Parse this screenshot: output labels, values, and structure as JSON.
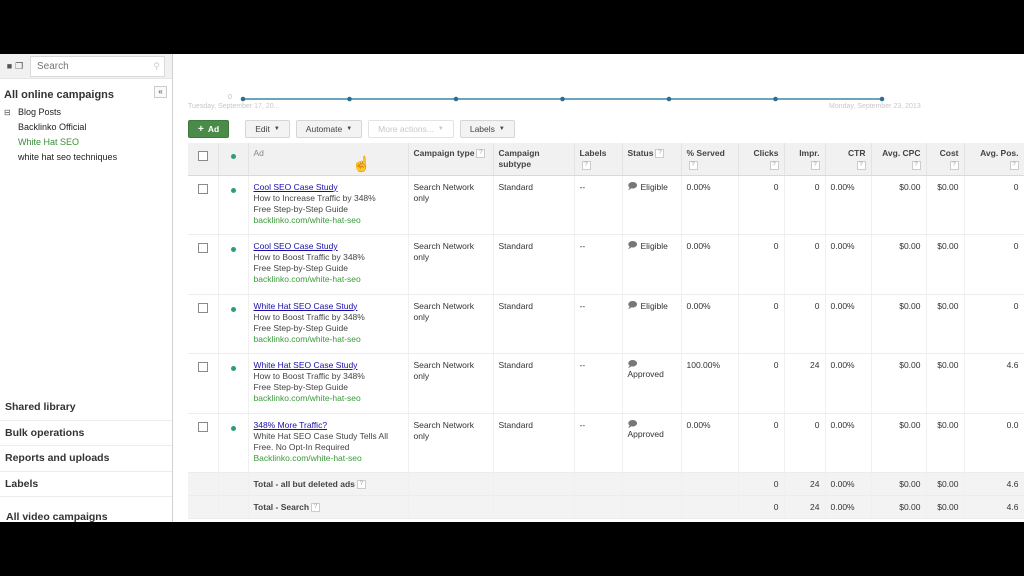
{
  "sidebar": {
    "search_placeholder": "Search",
    "icons": [
      "folder-icon",
      "window-icon"
    ],
    "heading": "All online campaigns",
    "collapse_label": "«",
    "tree": [
      {
        "label": "Blog Posts",
        "level": 0
      },
      {
        "label": "Backlinko Official",
        "level": 1
      },
      {
        "label": "White Hat SEO",
        "level": 1,
        "active": true
      },
      {
        "label": "white hat seo techniques",
        "level": 1
      }
    ],
    "links": [
      "Shared library",
      "Bulk operations",
      "Reports and uploads",
      "Labels"
    ],
    "bottom_heading": "All video campaigns"
  },
  "chart": {
    "y_zero_label": "0",
    "start_date": "Tuesday, September 17, 20...",
    "end_date": "Monday, September 23, 2013",
    "points": 7,
    "values": [
      0,
      0,
      0,
      0,
      0,
      0,
      0
    ],
    "line_color": "#3a86a8"
  },
  "toolbar": {
    "add_label": "Ad",
    "edit_label": "Edit",
    "automate_label": "Automate",
    "more_actions_label": "More actions...",
    "labels_label": "Labels"
  },
  "table": {
    "headers": {
      "ad": "Ad",
      "campaign_type": "Campaign type",
      "campaign_subtype": "Campaign subtype",
      "labels": "Labels",
      "status": "Status",
      "served": "% Served",
      "clicks": "Clicks",
      "impr": "Impr.",
      "ctr": "CTR",
      "avg_cpc": "Avg. CPC",
      "cost": "Cost",
      "avg_pos": "Avg. Pos."
    },
    "help_mark": "?",
    "rows": [
      {
        "title": "Cool SEO Case Study",
        "line1": "How to Increase Traffic by 348%",
        "line2": "Free Step-by-Step Guide",
        "url": "backlinko.com/white-hat-seo",
        "campaign_type": "Search Network only",
        "subtype": "Standard",
        "labels": "--",
        "status": "Eligible",
        "served": "0.00%",
        "clicks": "0",
        "impr": "0",
        "ctr": "0.00%",
        "avg_cpc": "$0.00",
        "cost": "$0.00",
        "avg_pos": "0"
      },
      {
        "title": "Cool SEO Case Study",
        "line1": "How to Boost Traffic by 348%",
        "line2": "Free Step-by-Step Guide",
        "url": "backlinko.com/white-hat-seo",
        "campaign_type": "Search Network only",
        "subtype": "Standard",
        "labels": "--",
        "status": "Eligible",
        "served": "0.00%",
        "clicks": "0",
        "impr": "0",
        "ctr": "0.00%",
        "avg_cpc": "$0.00",
        "cost": "$0.00",
        "avg_pos": "0"
      },
      {
        "title": "White Hat SEO Case Study",
        "line1": "How to Boost Traffic by 348%",
        "line2": "Free Step-by-Step Guide",
        "url": "backlinko.com/white-hat-seo",
        "campaign_type": "Search Network only",
        "subtype": "Standard",
        "labels": "--",
        "status": "Eligible",
        "served": "0.00%",
        "clicks": "0",
        "impr": "0",
        "ctr": "0.00%",
        "avg_cpc": "$0.00",
        "cost": "$0.00",
        "avg_pos": "0"
      },
      {
        "title": "White Hat SEO Case Study",
        "line1": "How to Boost Traffic by 348%",
        "line2": "Free Step-by-Step Guide",
        "url": "backlinko.com/white-hat-seo",
        "campaign_type": "Search Network only",
        "subtype": "Standard",
        "labels": "--",
        "status": "Approved",
        "served": "100.00%",
        "clicks": "0",
        "impr": "24",
        "ctr": "0.00%",
        "avg_cpc": "$0.00",
        "cost": "$0.00",
        "avg_pos": "4.6"
      },
      {
        "title": "348% More Traffic?",
        "line1": "White Hat SEO Case Study Tells All",
        "line2": "Free. No Opt-In Required",
        "url": "Backlinko.com/white-hat-seo",
        "campaign_type": "Search Network only",
        "subtype": "Standard",
        "labels": "--",
        "status": "Approved",
        "served": "0.00%",
        "clicks": "0",
        "impr": "0",
        "ctr": "0.00%",
        "avg_cpc": "$0.00",
        "cost": "$0.00",
        "avg_pos": "0.0"
      }
    ],
    "totals": [
      {
        "label": "Total - all but deleted ads",
        "clicks": "0",
        "impr": "24",
        "ctr": "0.00%",
        "avg_cpc": "$0.00",
        "cost": "$0.00",
        "avg_pos": "4.6"
      },
      {
        "label": "Total - Search",
        "clicks": "0",
        "impr": "24",
        "ctr": "0.00%",
        "avg_cpc": "$0.00",
        "cost": "$0.00",
        "avg_pos": "4.6"
      }
    ]
  }
}
